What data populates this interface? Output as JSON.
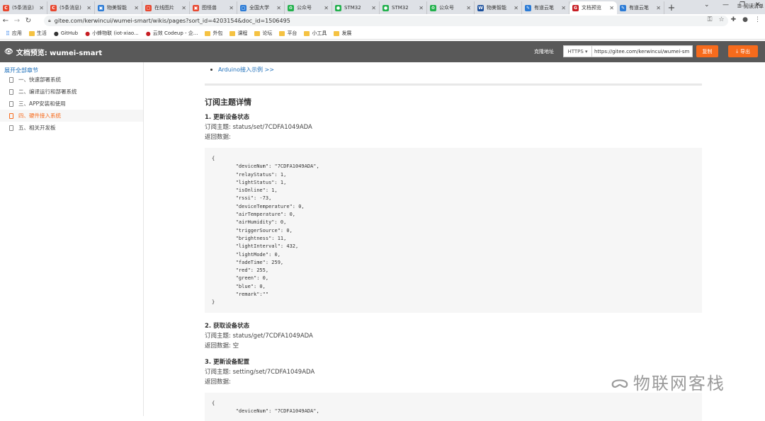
{
  "browser": {
    "tabs": [
      {
        "title": "(5条消息)",
        "color": "#e8462e",
        "glyph": "C"
      },
      {
        "title": "(5条消息)",
        "color": "#e8462e",
        "glyph": "C"
      },
      {
        "title": "物美智能",
        "color": "#2b7bd6",
        "glyph": "▣"
      },
      {
        "title": "在线图片",
        "color": "#e8462e",
        "glyph": "▢"
      },
      {
        "title": "图怪兽",
        "color": "#e8462e",
        "glyph": "▣"
      },
      {
        "title": "全国大学",
        "color": "#2b7bd6",
        "glyph": "▢"
      },
      {
        "title": "公众号",
        "color": "#22b14c",
        "glyph": "♻"
      },
      {
        "title": "STM32",
        "color": "#22b14c",
        "glyph": "●"
      },
      {
        "title": "STM32",
        "color": "#22b14c",
        "glyph": "●"
      },
      {
        "title": "公众号",
        "color": "#22b14c",
        "glyph": "♻"
      },
      {
        "title": "物美智能",
        "color": "#1b4f9c",
        "glyph": "W"
      },
      {
        "title": "有道云笔",
        "color": "#2b7bd6",
        "glyph": "✎"
      },
      {
        "title": "文档预览",
        "color": "#c71d23",
        "glyph": "G",
        "active": true
      },
      {
        "title": "有道云笔",
        "color": "#2b7bd6",
        "glyph": "✎"
      }
    ],
    "address": "gitee.com/kerwincui/wumei-smart/wikis/pages?sort_id=4203154&doc_id=1506495",
    "bookmarks": [
      {
        "label": "应用",
        "type": "apps"
      },
      {
        "label": "生活",
        "type": "folder"
      },
      {
        "label": "GitHub",
        "type": "github"
      },
      {
        "label": "小蜂物联 (iot-xiao...",
        "type": "red"
      },
      {
        "label": "云效 Codeup - 企...",
        "type": "red"
      },
      {
        "label": "外包",
        "type": "folder"
      },
      {
        "label": "课程",
        "type": "folder"
      },
      {
        "label": "论坛",
        "type": "folder"
      },
      {
        "label": "平台",
        "type": "folder"
      },
      {
        "label": "小工具",
        "type": "folder"
      },
      {
        "label": "发展",
        "type": "folder"
      }
    ],
    "reading_list": "阅读清单"
  },
  "header": {
    "title": "文档预览: wumei-smart",
    "share_label": "克隆地址",
    "protocol": "HTTPS ▾",
    "clone_url": "https://gitee.com/kerwincui/wumei-sm",
    "copy_label": "复制",
    "export_label": "导出"
  },
  "sidebar": {
    "expand_all": "展开全部章节",
    "items": [
      {
        "label": "一、快速部署系统"
      },
      {
        "label": "二、编译运行和部署系统"
      },
      {
        "label": "三、APP安装和使用"
      },
      {
        "label": "四、硬件接入系统",
        "active": true
      },
      {
        "label": "五、相关开发板"
      }
    ]
  },
  "content": {
    "prev_link": "Arduino接入示例 >>",
    "section_title": "订阅主题详情",
    "s1": {
      "heading": "1. 更新设备状态",
      "topic": "订阅主题: status/set/7CDFA1049ADA",
      "ret": "返回数据:",
      "code": [
        "{",
        "        \"deviceNum\": \"7CDFA1049ADA\",",
        "        \"relayStatus\": 1,",
        "        \"lightStatus\": 1,",
        "        \"isOnline\": 1,",
        "        \"rssi\": -73,",
        "        \"deviceTemperature\": 0,",
        "        \"airTemperature\": 0,",
        "        \"airHumidity\": 0,",
        "        \"triggerSource\": 0,",
        "        \"brightness\": 11,",
        "        \"lightInterval\": 432,",
        "        \"lightMode\": 0,",
        "        \"fadeTime\": 259,",
        "        \"red\": 255,",
        "        \"green\": 0,",
        "        \"blue\": 0,",
        "        \"remark\":\"\"",
        "}"
      ]
    },
    "s2": {
      "heading": "2. 获取设备状态",
      "topic": "订阅主题: status/get/7CDFA1049ADA",
      "ret": "返回数据: 空"
    },
    "s3": {
      "heading": "3. 更新设备配置",
      "topic": "订阅主题: setting/set/7CDFA1049ADA",
      "ret": "返回数据:",
      "code": [
        "{",
        "        \"deviceNum\": \"7CDFA1049ADA\","
      ]
    }
  },
  "watermark": "物联网客栈"
}
